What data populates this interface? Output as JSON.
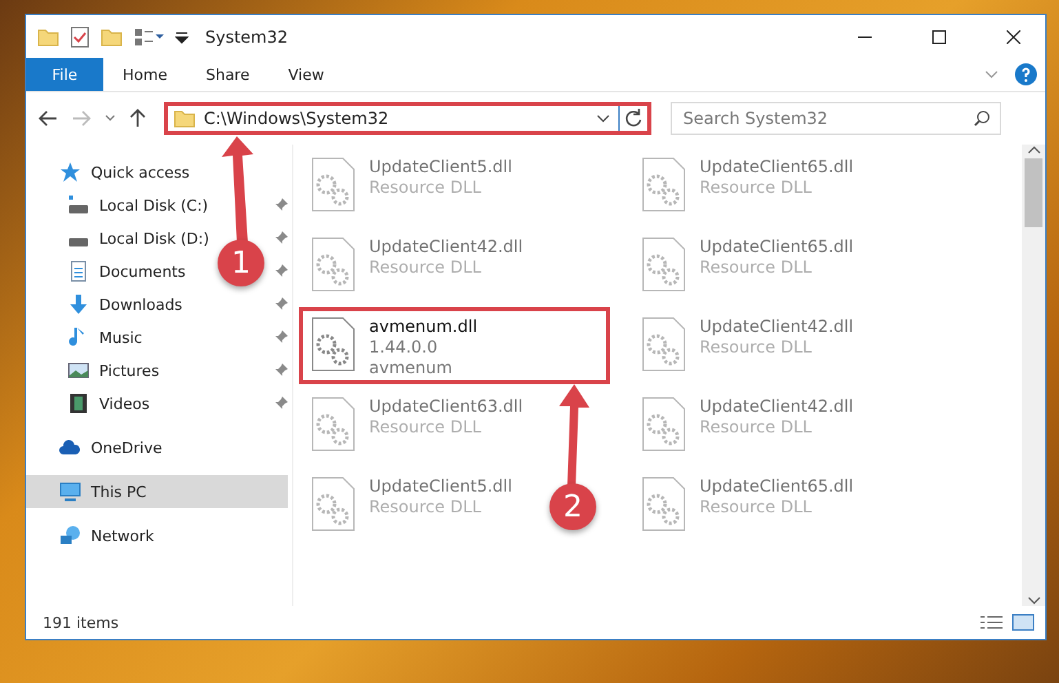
{
  "window": {
    "title": "System32"
  },
  "ribbon": {
    "tabs": [
      {
        "label": "File",
        "selected": true
      },
      {
        "label": "Home",
        "selected": false
      },
      {
        "label": "Share",
        "selected": false
      },
      {
        "label": "View",
        "selected": false
      }
    ]
  },
  "address": {
    "path": "C:\\Windows\\System32",
    "highlighted": true
  },
  "search": {
    "placeholder": "Search System32"
  },
  "sidebar": {
    "items": [
      {
        "label": "Quick access",
        "kind": "star",
        "selected": false,
        "children": [
          {
            "label": "Local Disk (C:)",
            "kind": "drive-c",
            "pinned": true
          },
          {
            "label": "Local Disk (D:)",
            "kind": "drive",
            "pinned": true
          },
          {
            "label": "Documents",
            "kind": "document",
            "pinned": true
          },
          {
            "label": "Downloads",
            "kind": "download",
            "pinned": true
          },
          {
            "label": "Music",
            "kind": "music",
            "pinned": true
          },
          {
            "label": "Pictures",
            "kind": "picture",
            "pinned": true
          },
          {
            "label": "Videos",
            "kind": "video",
            "pinned": true
          }
        ]
      },
      {
        "label": "OneDrive",
        "kind": "cloud",
        "selected": false
      },
      {
        "label": "This PC",
        "kind": "pc",
        "selected": true
      },
      {
        "label": "Network",
        "kind": "network",
        "selected": false
      }
    ]
  },
  "files": [
    {
      "name": "UpdateClient5.dll",
      "lines": [
        "Resource DLL"
      ],
      "highlighted": false
    },
    {
      "name": "UpdateClient65.dll",
      "lines": [
        "Resource DLL"
      ],
      "highlighted": false
    },
    {
      "name": "UpdateClient42.dll",
      "lines": [
        "Resource DLL"
      ],
      "highlighted": false
    },
    {
      "name": "UpdateClient65.dll",
      "lines": [
        "Resource DLL"
      ],
      "highlighted": false
    },
    {
      "name": "avmenum.dll",
      "lines": [
        "1.44.0.0",
        "avmenum"
      ],
      "highlighted": true
    },
    {
      "name": "UpdateClient42.dll",
      "lines": [
        "Resource DLL"
      ],
      "highlighted": false
    },
    {
      "name": "UpdateClient63.dll",
      "lines": [
        "Resource DLL"
      ],
      "highlighted": false
    },
    {
      "name": "UpdateClient42.dll",
      "lines": [
        "Resource DLL"
      ],
      "highlighted": false
    },
    {
      "name": "UpdateClient5.dll",
      "lines": [
        "Resource DLL"
      ],
      "highlighted": false
    },
    {
      "name": "UpdateClient65.dll",
      "lines": [
        "Resource DLL"
      ],
      "highlighted": false
    }
  ],
  "status_bar": {
    "count": "191 items"
  },
  "annotations": [
    {
      "number": "1"
    },
    {
      "number": "2"
    }
  ]
}
